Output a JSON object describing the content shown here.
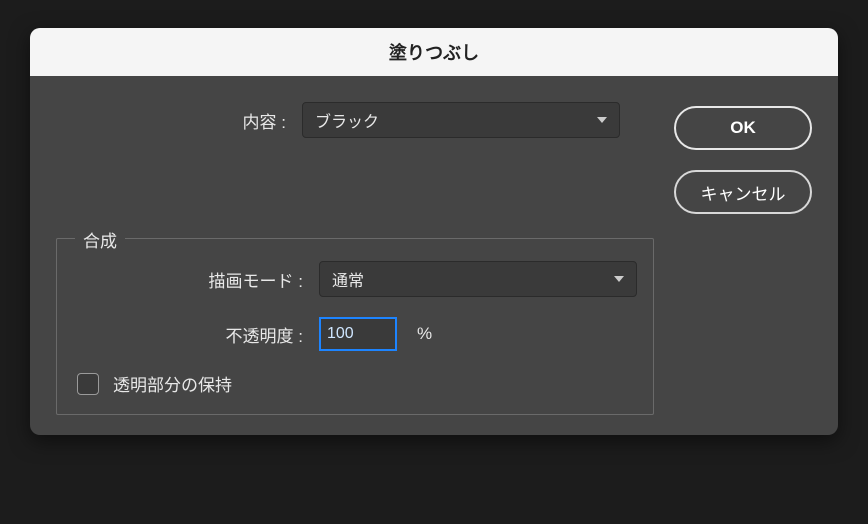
{
  "dialog": {
    "title": "塗りつぶし"
  },
  "content": {
    "label": "内容 :",
    "value": "ブラック"
  },
  "compositing": {
    "legend": "合成",
    "mode_label": "描画モード :",
    "mode_value": "通常",
    "opacity_label": "不透明度 :",
    "opacity_value": "100",
    "opacity_unit": "%",
    "preserve_label": "透明部分の保持",
    "preserve_checked": false
  },
  "buttons": {
    "ok": "OK",
    "cancel": "キャンセル"
  }
}
